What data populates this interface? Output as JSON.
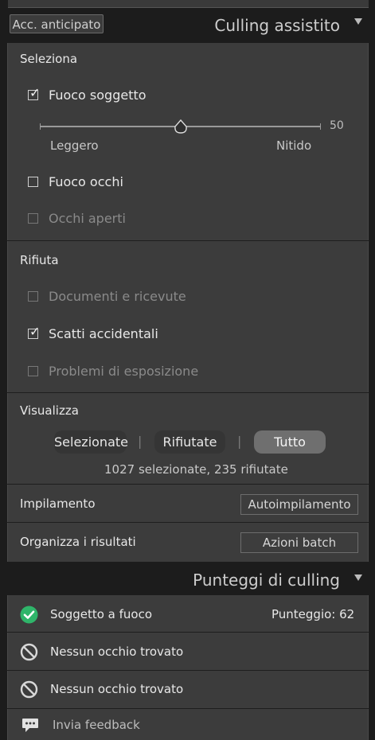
{
  "header": {
    "early_access_label": "Acc. anticipato",
    "title": "Culling assistito"
  },
  "select_section": {
    "heading": "Seleziona",
    "subject_focus": {
      "label": "Fuoco soggetto",
      "checked": true
    },
    "slider": {
      "value": "50",
      "min_label": "Leggero",
      "max_label": "Nitido"
    },
    "eye_focus": {
      "label": "Fuoco occhi",
      "checked": false
    },
    "eyes_open": {
      "label": "Occhi aperti",
      "checked": false,
      "disabled": true
    }
  },
  "reject_section": {
    "heading": "Rifiuta",
    "documents": {
      "label": "Documenti e ricevute",
      "checked": false,
      "disabled": true
    },
    "accidental": {
      "label": "Scatti accidentali",
      "checked": true
    },
    "exposure": {
      "label": "Problemi di esposizione",
      "checked": false,
      "disabled": true
    }
  },
  "view_section": {
    "heading": "Visualizza",
    "options": [
      "Selezionate",
      "Rifiutate",
      "Tutto"
    ],
    "active_option": "Tutto",
    "summary": "1027 selezionate, 235 rifiutate"
  },
  "stacking": {
    "label": "Impilamento",
    "button_label": "Autoimpilamento"
  },
  "organize": {
    "label": "Organizza i risultati",
    "button_label": "Azioni batch"
  },
  "scores_panel": {
    "title": "Punteggi di culling",
    "rows": [
      {
        "label": "Soggetto a fuoco",
        "score": "Punteggio: 62",
        "icon": "check-circle-icon"
      },
      {
        "label": "Nessun occhio trovato",
        "icon": "prohibited-icon"
      },
      {
        "label": "Nessun occhio trovato",
        "icon": "prohibited-icon"
      }
    ],
    "feedback_label": "Invia feedback"
  },
  "colors": {
    "panel_bg": "#3c3c3c",
    "dark_bg": "#1c1c1c",
    "success_green": "#2fb56a",
    "active_toggle": "#6f6f6f"
  }
}
